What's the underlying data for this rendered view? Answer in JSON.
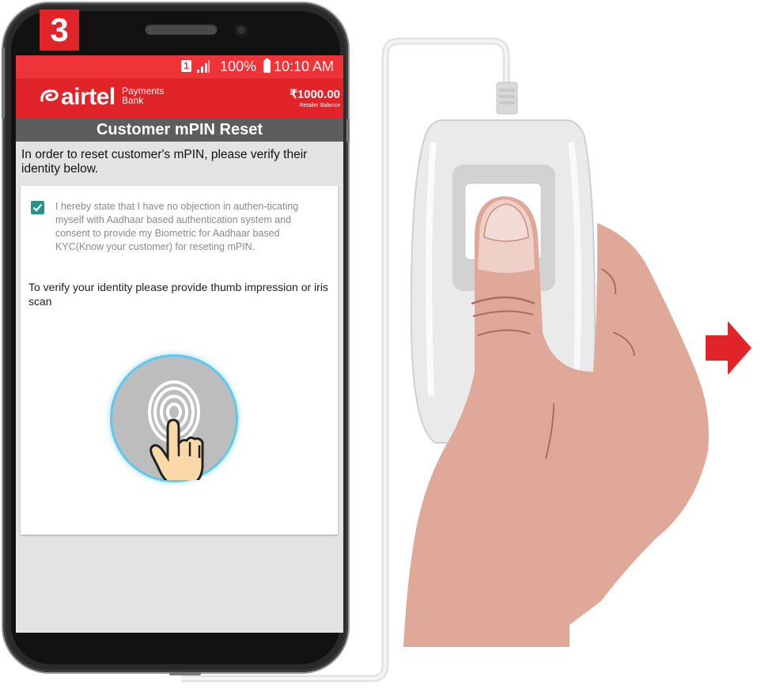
{
  "step_badge": "3",
  "status_bar": {
    "sim": "1",
    "battery": "100%",
    "time": "10:10 AM"
  },
  "brand": {
    "name": "airtel",
    "sub_line1": "Payments",
    "sub_line2": "Bank",
    "balance": "₹1000.00",
    "balance_label": "Retailer Balance"
  },
  "screen_title": "Customer mPIN Reset",
  "intro_text": "In order to reset customer's mPIN, please verify their identity below.",
  "consent": {
    "checked": true,
    "text": "I hereby state that I have no objection in authen-ticating myself with Aadhaar based authentication system and consent to provide my Biometric for Aadhaar based KYC(Know your customer) for reseting mPIN."
  },
  "verify_prompt": "To verify your identity please provide thumb impression or iris scan",
  "colors": {
    "brand_red": "#e0242a",
    "status_red": "#ee3339",
    "title_gray": "#5d5d5d",
    "checkbox_teal": "#27928a",
    "scan_glow": "#5ec8ef"
  },
  "icons": {
    "fingerprint": "fingerprint-icon",
    "checkbox": "check-icon",
    "next_arrow": "arrow-right-icon"
  }
}
